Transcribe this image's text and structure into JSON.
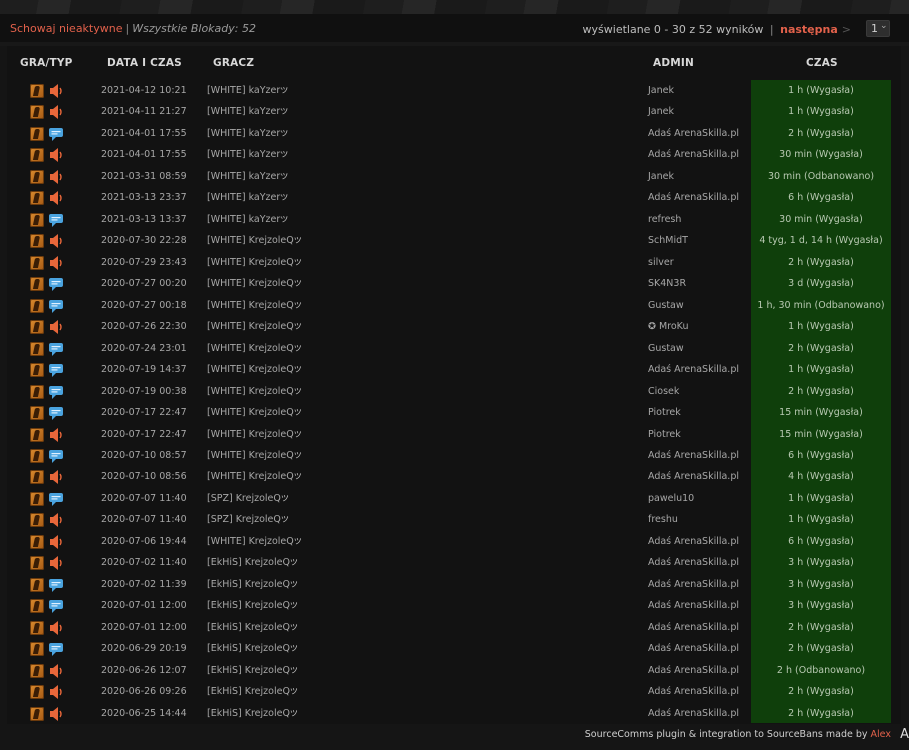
{
  "topbar": {
    "hide_inactive": "Schowaj nieaktywne",
    "separator": "|",
    "total_label": "Wszystkie Blokady:",
    "total_count": "52",
    "showing": "wyświetlane 0 - 30 z 52 wyników",
    "next": "następna",
    "page": "1"
  },
  "headers": {
    "game_type": "GRA/TYP",
    "date": "DATA I CZAS",
    "player": "GRACZ",
    "admin": "ADMIN",
    "time": "CZAS"
  },
  "rows": [
    {
      "type": "voice",
      "date": "2021-04-12 10:21",
      "player": "[WHITE] kaYzer",
      "flame": "ツ",
      "admin": "Janek",
      "time": "1 h (Wygasła)"
    },
    {
      "type": "voice",
      "date": "2021-04-11 21:27",
      "player": "[WHITE] kaYzer",
      "flame": "ツ",
      "admin": "Janek",
      "time": "1 h (Wygasła)"
    },
    {
      "type": "chat",
      "date": "2021-04-01 17:55",
      "player": "[WHITE] kaYzer",
      "flame": "ツ",
      "admin": "Adaś ArenaSkilla.pl",
      "time": "2 h (Wygasła)"
    },
    {
      "type": "voice",
      "date": "2021-04-01 17:55",
      "player": "[WHITE] kaYzer",
      "flame": "ツ",
      "admin": "Adaś ArenaSkilla.pl",
      "time": "30 min (Wygasła)"
    },
    {
      "type": "voice",
      "date": "2021-03-31 08:59",
      "player": "[WHITE] kaYzer",
      "flame": "ツ",
      "admin": "Janek",
      "time": "30 min (Odbanowano)"
    },
    {
      "type": "voice",
      "date": "2021-03-13 23:37",
      "player": "[WHITE] kaYzer",
      "flame": "ツ",
      "admin": "Adaś ArenaSkilla.pl",
      "time": "6 h (Wygasła)"
    },
    {
      "type": "chat",
      "date": "2021-03-13 13:37",
      "player": "[WHITE] kaYzer",
      "flame": "ツ",
      "admin": "refresh",
      "time": "30 min (Wygasła)"
    },
    {
      "type": "voice",
      "date": "2020-07-30 22:28",
      "player": "[WHITE] KrejzoleQ",
      "flame": "ツ",
      "admin": "SchMidT",
      "time": "4 tyg, 1 d, 14 h (Wygasła)"
    },
    {
      "type": "voice",
      "date": "2020-07-29 23:43",
      "player": "[WHITE] KrejzoleQ",
      "flame": "ツ",
      "admin": "silver",
      "time": "2 h (Wygasła)"
    },
    {
      "type": "chat",
      "date": "2020-07-27 00:20",
      "player": "[WHITE] KrejzoleQ",
      "flame": "ツ",
      "admin": "SK4N3R",
      "time": "3 d (Wygasła)"
    },
    {
      "type": "chat",
      "date": "2020-07-27 00:18",
      "player": "[WHITE] KrejzoleQ",
      "flame": "ツ",
      "admin": "Gustaw",
      "time": "1 h, 30 min (Odbanowano)"
    },
    {
      "type": "voice",
      "date": "2020-07-26 22:30",
      "player": "[WHITE] KrejzoleQ",
      "flame": "ツ",
      "admin": "✪ MroKu",
      "time": "1 h (Wygasła)"
    },
    {
      "type": "chat",
      "date": "2020-07-24 23:01",
      "player": "[WHITE] KrejzoleQ",
      "flame": "ツ",
      "admin": "Gustaw",
      "time": "2 h (Wygasła)"
    },
    {
      "type": "chat",
      "date": "2020-07-19 14:37",
      "player": "[WHITE] KrejzoleQ",
      "flame": "ツ",
      "admin": "Adaś ArenaSkilla.pl",
      "time": "1 h (Wygasła)"
    },
    {
      "type": "chat",
      "date": "2020-07-19 00:38",
      "player": "[WHITE] KrejzoleQ",
      "flame": "ツ",
      "admin": "Ciosek",
      "time": "2 h (Wygasła)"
    },
    {
      "type": "chat",
      "date": "2020-07-17 22:47",
      "player": "[WHITE] KrejzoleQ",
      "flame": "ツ",
      "admin": "Piotrek",
      "time": "15 min (Wygasła)"
    },
    {
      "type": "voice",
      "date": "2020-07-17 22:47",
      "player": "[WHITE] KrejzoleQ",
      "flame": "ツ",
      "admin": "Piotrek",
      "time": "15 min (Wygasła)"
    },
    {
      "type": "chat",
      "date": "2020-07-10 08:57",
      "player": "[WHITE] KrejzoleQ",
      "flame": "ツ",
      "admin": "Adaś ArenaSkilla.pl",
      "time": "6 h (Wygasła)"
    },
    {
      "type": "voice",
      "date": "2020-07-10 08:56",
      "player": "[WHITE] KrejzoleQ",
      "flame": "ツ",
      "admin": "Adaś ArenaSkilla.pl",
      "time": "4 h (Wygasła)"
    },
    {
      "type": "chat",
      "date": "2020-07-07 11:40",
      "player": "[SPZ] KrejzoleQ",
      "flame": "ツ",
      "admin": "pawelu10",
      "time": "1 h (Wygasła)"
    },
    {
      "type": "voice",
      "date": "2020-07-07 11:40",
      "player": "[SPZ] KrejzoleQ",
      "flame": "ツ",
      "admin": "freshu",
      "time": "1 h (Wygasła)"
    },
    {
      "type": "voice",
      "date": "2020-07-06 19:44",
      "player": "[WHITE] KrejzoleQ",
      "flame": "ツ",
      "admin": "Adaś ArenaSkilla.pl",
      "time": "6 h (Wygasła)"
    },
    {
      "type": "voice",
      "date": "2020-07-02 11:40",
      "player": "[EkHiS] KrejzoleQ",
      "flame": "ツ",
      "admin": "Adaś ArenaSkilla.pl",
      "time": "3 h (Wygasła)"
    },
    {
      "type": "chat",
      "date": "2020-07-02 11:39",
      "player": "[EkHiS] KrejzoleQ",
      "flame": "ツ",
      "admin": "Adaś ArenaSkilla.pl",
      "time": "3 h (Wygasła)"
    },
    {
      "type": "chat",
      "date": "2020-07-01 12:00",
      "player": "[EkHiS] KrejzoleQ",
      "flame": "ツ",
      "admin": "Adaś ArenaSkilla.pl",
      "time": "3 h (Wygasła)"
    },
    {
      "type": "voice",
      "date": "2020-07-01 12:00",
      "player": "[EkHiS] KrejzoleQ",
      "flame": "ツ",
      "admin": "Adaś ArenaSkilla.pl",
      "time": "2 h (Wygasła)"
    },
    {
      "type": "chat",
      "date": "2020-06-29 20:19",
      "player": "[EkHiS] KrejzoleQ",
      "flame": "ツ",
      "admin": "Adaś ArenaSkilla.pl",
      "time": "2 h (Wygasła)"
    },
    {
      "type": "voice",
      "date": "2020-06-26 12:07",
      "player": "[EkHiS] KrejzoleQ",
      "flame": "ツ",
      "admin": "Adaś ArenaSkilla.pl",
      "time": "2 h (Odbanowano)"
    },
    {
      "type": "voice",
      "date": "2020-06-26 09:26",
      "player": "[EkHiS] KrejzoleQ",
      "flame": "ツ",
      "admin": "Adaś ArenaSkilla.pl",
      "time": "2 h (Wygasła)"
    },
    {
      "type": "voice",
      "date": "2020-06-25 14:44",
      "player": "[EkHiS] KrejzoleQ",
      "flame": "ツ",
      "admin": "Adaś ArenaSkilla.pl",
      "time": "2 h (Wygasła)"
    }
  ],
  "footer": {
    "text": "SourceComms plugin & integration to SourceBans made by",
    "author": "Alex",
    "corner": "A"
  },
  "colors": {
    "accent": "#e2614b",
    "time_bg": "#0f3f0b",
    "page_bg": "#151515"
  },
  "icons": {
    "game": "counter-strike-icon",
    "voice": "speaker-icon",
    "chat": "chat-bubble-icon"
  }
}
